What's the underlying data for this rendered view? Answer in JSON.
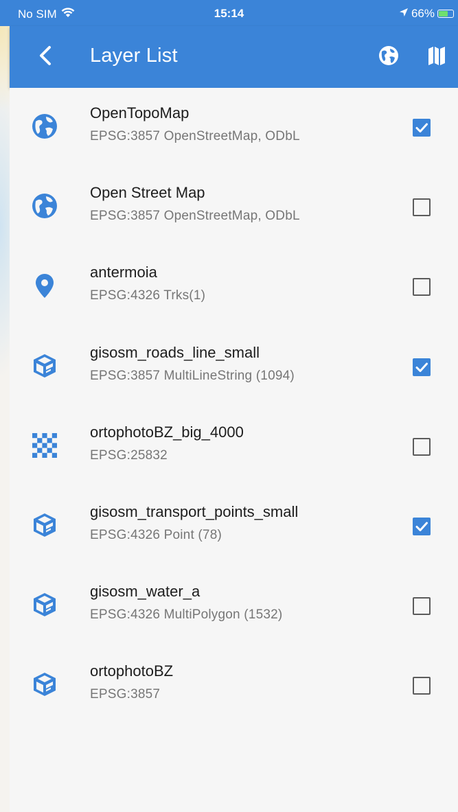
{
  "status_bar": {
    "carrier": "No SIM",
    "time": "15:14",
    "battery": "66%",
    "battery_level": 0.66
  },
  "app_bar": {
    "title": "Layer List",
    "back_icon": "back-arrow-icon",
    "actions": [
      "globe-icon",
      "map-icon"
    ]
  },
  "colors": {
    "accent": "#3b84d8",
    "checkbox_border": "#5b5b5b",
    "subtitle": "#767676"
  },
  "layers": [
    {
      "name": "OpenTopoMap",
      "subtitle": "EPSG:3857 OpenStreetMap, ODbL",
      "icon": "globe-icon",
      "checked": true
    },
    {
      "name": "Open Street Map",
      "subtitle": "EPSG:3857 OpenStreetMap, ODbL",
      "icon": "globe-icon",
      "checked": false
    },
    {
      "name": "antermoia",
      "subtitle": "EPSG:4326 Trks(1)",
      "icon": "map-pin-icon",
      "checked": false
    },
    {
      "name": "gisosm_roads_line_small",
      "subtitle": "EPSG:3857 MultiLineString (1094)",
      "icon": "vector-box-icon",
      "checked": true
    },
    {
      "name": "ortophotoBZ_big_4000",
      "subtitle": "EPSG:25832",
      "icon": "checkerboard-icon",
      "checked": false
    },
    {
      "name": "gisosm_transport_points_small",
      "subtitle": "EPSG:4326 Point (78)",
      "icon": "vector-box-icon",
      "checked": true
    },
    {
      "name": "gisosm_water_a",
      "subtitle": "EPSG:4326 MultiPolygon (1532)",
      "icon": "vector-box-icon",
      "checked": false
    },
    {
      "name": "ortophotoBZ",
      "subtitle": "EPSG:3857",
      "icon": "vector-box-icon",
      "checked": false
    }
  ]
}
